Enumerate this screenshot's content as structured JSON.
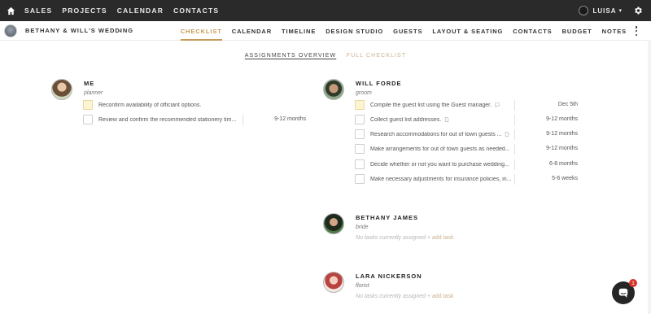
{
  "topbar": {
    "nav": [
      "SALES",
      "PROJECTS",
      "CALENDAR",
      "CONTACTS"
    ],
    "user": "LUISA"
  },
  "project": {
    "name": "BETHANY & WILL'S WEDDING",
    "tabs": [
      "CHECKLIST",
      "CALENDAR",
      "TIMELINE",
      "DESIGN STUDIO",
      "GUESTS",
      "LAYOUT & SEATING",
      "CONTACTS",
      "BUDGET",
      "NOTES"
    ],
    "active_tab": "CHECKLIST"
  },
  "subtabs": {
    "active": "ASSIGNMENTS OVERVIEW",
    "inactive": "FULL CHECKLIST"
  },
  "assignees": {
    "me": {
      "name": "ME",
      "role": "planner",
      "tasks": [
        {
          "text": "Reconfirm availability of officiant options.",
          "date": ""
        },
        {
          "text": "Review and confirm the recommended stationery tim...",
          "date": "9-12 months"
        }
      ]
    },
    "will": {
      "name": "WILL FORDE",
      "role": "groom",
      "tasks": [
        {
          "text": "Compile the guest list using the Guest manager.",
          "date": "Dec 5th"
        },
        {
          "text": "Collect guest list addresses.",
          "date": "9-12 months"
        },
        {
          "text": "Research accommodations for out of town guests ...",
          "date": "9-12 months"
        },
        {
          "text": "Make arrangements for out of town guests as needed...",
          "date": "9-12 months"
        },
        {
          "text": "Decide whether or not you want to purchase wedding...",
          "date": "6-8 months"
        },
        {
          "text": "Make necessary adjustments for insurance policies, in...",
          "date": "5-6 weeks"
        }
      ]
    },
    "bethany": {
      "name": "BETHANY JAMES",
      "role": "bride",
      "empty": "No tasks currently assigned",
      "add": "+ add task"
    },
    "lara": {
      "name": "LARA NICKERSON",
      "role": "florist",
      "empty": "No tasks currently assigned",
      "add": "+ add task"
    }
  },
  "chat": {
    "badge": "1"
  },
  "colors": {
    "accent": "#c49a57",
    "topbar": "#2a2a2a",
    "highlight": "#fdf5cf",
    "badge": "#d9342b"
  },
  "icons": [
    "home-icon",
    "gear-icon",
    "chevron-down-icon",
    "comment-icon",
    "note-icon",
    "kebab-menu-icon",
    "chat-icon"
  ]
}
